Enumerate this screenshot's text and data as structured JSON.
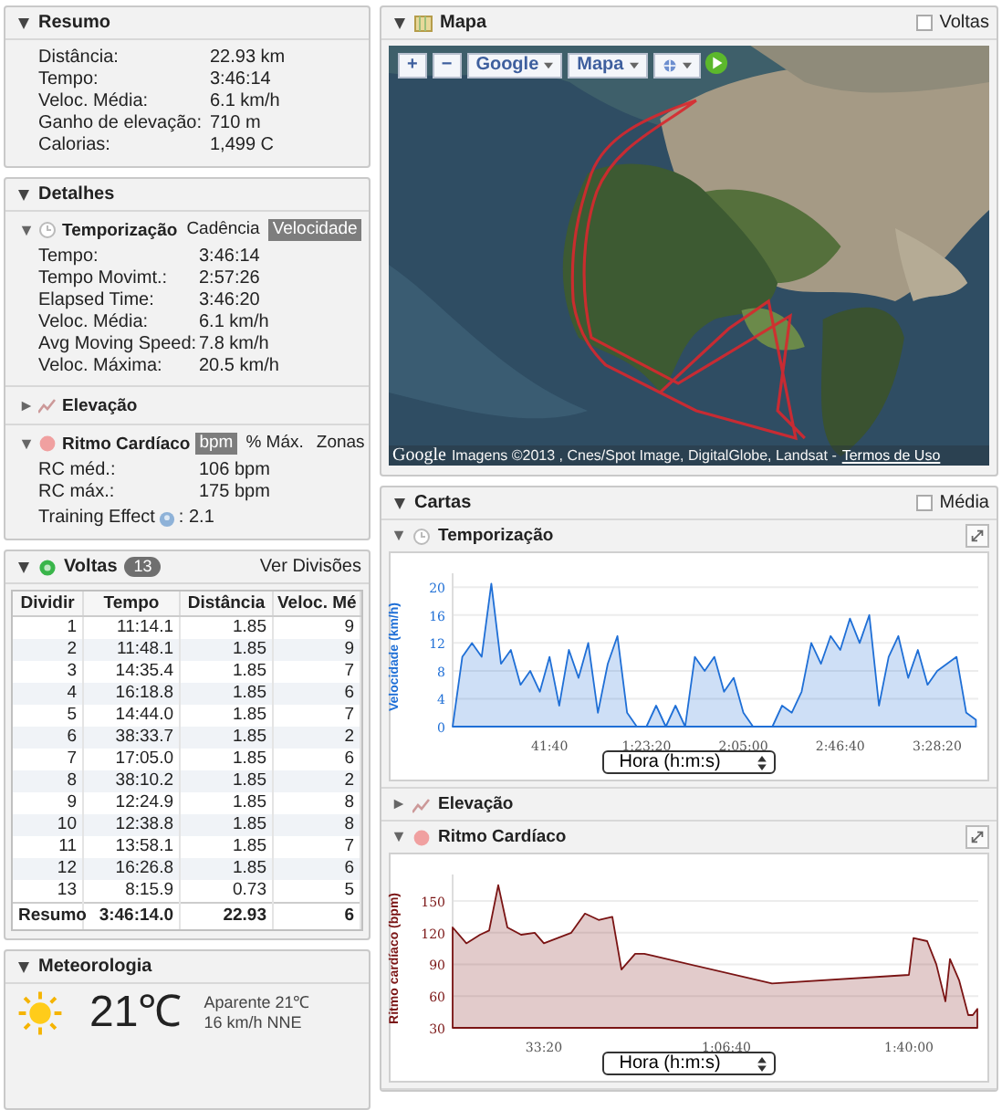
{
  "resumo": {
    "title": "Resumo",
    "expanded": true,
    "rows": [
      {
        "label": "Distância:",
        "value": "22.93 km"
      },
      {
        "label": "Tempo:",
        "value": "3:46:14"
      },
      {
        "label": "Veloc. Média:",
        "value": "6.1 km/h"
      },
      {
        "label": "Ganho de elevação:",
        "value": "710 m"
      },
      {
        "label": "Calorias:",
        "value": "1,499 C"
      }
    ]
  },
  "detalhes": {
    "title": "Detalhes",
    "expanded": true,
    "sections": [
      {
        "title": "Temporização",
        "kind": "clock",
        "expanded": true,
        "options": [
          {
            "label": "Cadência",
            "selected": false
          },
          {
            "label": "Velocidade",
            "selected": true
          }
        ],
        "rows": [
          {
            "label": "Tempo:",
            "value": "3:46:14"
          },
          {
            "label": "Tempo Movimt.:",
            "value": "2:57:26"
          },
          {
            "label": "Elapsed Time:",
            "value": "3:46:20"
          },
          {
            "label": "Veloc. Média:",
            "value": "6.1 km/h"
          },
          {
            "label": "Avg Moving Speed:",
            "value": "7.8 km/h"
          },
          {
            "label": "Veloc. Máxima:",
            "value": "20.5 km/h"
          }
        ]
      },
      {
        "title": "Elevação",
        "kind": "elevation",
        "expanded": false
      },
      {
        "title": "Ritmo Cardíaco",
        "kind": "heart",
        "expanded": true,
        "options": [
          {
            "label": "bpm",
            "selected": true
          },
          {
            "label": "% Máx.",
            "selected": false
          },
          {
            "label": "Zonas",
            "selected": false
          }
        ],
        "rows": [
          {
            "label": "RC méd.:",
            "value": "106 bpm"
          },
          {
            "label": "RC máx.:",
            "value": "175 bpm"
          }
        ],
        "training_effect": {
          "label": "Training Effect",
          "value": ": 2.1"
        }
      }
    ]
  },
  "voltas": {
    "title": "Voltas",
    "badge": "13",
    "expanded": true,
    "link": "Ver Divisões",
    "columns": [
      "Dividir",
      "Tempo",
      "Distância",
      "Veloc. Mé"
    ],
    "rows": [
      [
        "1",
        "11:14.1",
        "1.85",
        "9"
      ],
      [
        "2",
        "11:48.1",
        "1.85",
        "9"
      ],
      [
        "3",
        "14:35.4",
        "1.85",
        "7"
      ],
      [
        "4",
        "16:18.8",
        "1.85",
        "6"
      ],
      [
        "5",
        "14:44.0",
        "1.85",
        "7"
      ],
      [
        "6",
        "38:33.7",
        "1.85",
        "2"
      ],
      [
        "7",
        "17:05.0",
        "1.85",
        "6"
      ],
      [
        "8",
        "38:10.2",
        "1.85",
        "2"
      ],
      [
        "9",
        "12:24.9",
        "1.85",
        "8"
      ],
      [
        "10",
        "12:38.8",
        "1.85",
        "8"
      ],
      [
        "11",
        "13:58.1",
        "1.85",
        "7"
      ],
      [
        "12",
        "16:26.8",
        "1.85",
        "6"
      ],
      [
        "13",
        "8:15.9",
        "0.73",
        "5"
      ]
    ],
    "summary": [
      "Resumo",
      "3:46:14.0",
      "22.93",
      "6"
    ]
  },
  "meteorologia": {
    "title": "Meteorologia",
    "expanded": true,
    "temperature": "21℃",
    "apparent": "Aparente 21℃",
    "wind": "16 km/h NNE"
  },
  "mapa": {
    "title": "Mapa",
    "expanded": true,
    "option": {
      "label": "Voltas",
      "checked": false
    },
    "zoom_in": "+",
    "zoom_out": "−",
    "provider": "Google",
    "map_type": "Mapa",
    "logo": "Google",
    "attribution": "Imagens ©2013 , Cnes/Spot Image, DigitalGlobe, Landsat -",
    "terms": "Termos de Uso"
  },
  "cartas": {
    "title": "Cartas",
    "expanded": true,
    "option": {
      "label": "Média",
      "checked": false
    },
    "charts": [
      {
        "title": "Temporização",
        "kind": "clock",
        "expanded": true,
        "chart_data": {
          "type": "area",
          "grid": true,
          "xlabel": "Hora (h:m:s)",
          "ylabel": "Velocidade (km/h)",
          "x": [
            0,
            250,
            500,
            750,
            1000,
            1250,
            1500,
            1750,
            2000,
            2250,
            2500,
            2750,
            3000,
            3250,
            3500,
            3750,
            4000,
            4250,
            4500,
            4750,
            5000,
            5250,
            5500,
            5750,
            6000,
            6250,
            6500,
            6750,
            7000,
            7250,
            7500,
            7750,
            8000,
            8250,
            8500,
            8750,
            9000,
            9250,
            9500,
            9750,
            10000,
            10250,
            10500,
            10750,
            11000,
            11250,
            11500,
            11750,
            12000,
            12250,
            12500,
            12750,
            13000,
            13250,
            13500
          ],
          "series": [
            {
              "color": "#1f6fd6",
              "values": [
                0,
                10,
                12,
                10,
                20.5,
                9,
                11,
                6,
                8,
                5,
                10,
                3,
                11,
                7,
                12,
                2,
                9,
                13,
                2,
                0,
                0,
                3,
                0,
                3,
                0,
                10,
                8,
                10,
                5,
                7,
                2,
                0,
                0,
                0,
                3,
                2,
                5,
                12,
                9,
                13,
                11,
                15.5,
                12,
                16,
                3,
                10,
                13,
                7,
                11,
                6,
                8,
                9,
                10,
                2,
                1
              ]
            }
          ],
          "xlim": [
            0,
            13560
          ],
          "ylim": [
            0,
            22
          ],
          "xticks": [
            {
              "value": 2500,
              "label": "41:40"
            },
            {
              "value": 5000,
              "label": "1:23:20"
            },
            {
              "value": 7500,
              "label": "2:05:00"
            },
            {
              "value": 10000,
              "label": "2:46:40"
            },
            {
              "value": 12500,
              "label": "3:28:20"
            }
          ],
          "yticks": [
            0,
            4,
            8,
            12,
            16,
            20
          ]
        }
      },
      {
        "title": "Elevação",
        "kind": "elevation",
        "expanded": false
      },
      {
        "title": "Ritmo Cardíaco",
        "kind": "heart",
        "expanded": true,
        "chart_data": {
          "type": "area",
          "grid": true,
          "xlabel": "Hora (h:m:s)",
          "ylabel": "Ritmo cardíaco (bpm)",
          "x": [
            1000,
            1150,
            1300,
            1400,
            1500,
            1600,
            1750,
            1900,
            2000,
            2150,
            2300,
            2450,
            2600,
            2750,
            2850,
            3000,
            3100,
            3200,
            4500,
            6000,
            6050,
            6200,
            6300,
            6400,
            6450,
            6550,
            6650,
            6700,
            6750
          ],
          "series": [
            {
              "color": "#7a1414",
              "values": [
                125,
                110,
                118,
                122,
                165,
                125,
                118,
                120,
                110,
                115,
                120,
                138,
                132,
                135,
                85,
                100,
                100,
                98,
                72,
                80,
                115,
                112,
                90,
                55,
                95,
                75,
                42,
                42,
                48
              ]
            }
          ],
          "xlim": [
            1000,
            6760
          ],
          "ylim": [
            30,
            175
          ],
          "xticks": [
            {
              "value": 2000,
              "label": "33:20"
            },
            {
              "value": 4000,
              "label": "1:06:40"
            },
            {
              "value": 6000,
              "label": "1:40:00"
            }
          ],
          "yticks": [
            30,
            60,
            90,
            120,
            150
          ]
        }
      }
    ]
  }
}
